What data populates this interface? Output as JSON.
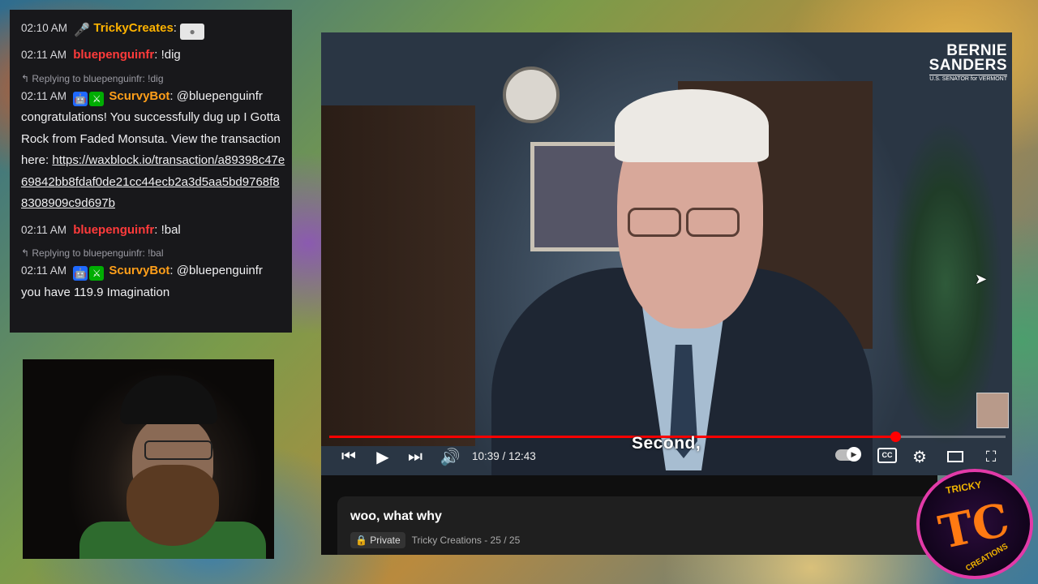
{
  "chat": {
    "messages": [
      {
        "time": "02:10 AM",
        "user": "TrickyCreates",
        "text": ""
      },
      {
        "time": "02:11 AM",
        "user": "bluepenguinfr",
        "text": "!dig"
      },
      {
        "reply": "Replying to bluepenguinfr: !dig",
        "time": "02:11 AM",
        "user": "ScurvyBot",
        "text": "@bluepenguinfr congratulations! You successfully dug up I Gotta Rock from Faded Monsuta. View the transaction here:",
        "link": "https://waxblock.io/transaction/a89398c47e69842bb8fdaf0de21cc44ecb2a3d5aa5bd9768f88308909c9d697b"
      },
      {
        "time": "02:11 AM",
        "user": "bluepenguinfr",
        "text": "!bal"
      },
      {
        "reply": "Replying to bluepenguinfr: !bal",
        "time": "02:11 AM",
        "user": "ScurvyBot",
        "text": "@bluepenguinfr you have 119.9 Imagination"
      }
    ]
  },
  "player": {
    "channel_logo": {
      "line1": "BERNIE",
      "line2": "SANDERS",
      "line3": "U.S. SENATOR for VERMONT"
    },
    "caption": "Second,",
    "time": "10:39 / 12:43",
    "progress": 0.837,
    "cc_label": "CC"
  },
  "video_info": {
    "title": "woo, what why",
    "privacy": "Private",
    "playlist": "Tricky Creations - 25 / 25"
  },
  "channel_badge": {
    "line1": "TRICKY",
    "line2": "TC",
    "line3": "CREATIONS"
  },
  "colors": {
    "accent_red": "#ff0000",
    "bot_badge": "#1f69ff",
    "mod_badge": "#00ad03",
    "username_orange": "#ff9f1a",
    "username_red": "#ff3b3b"
  }
}
